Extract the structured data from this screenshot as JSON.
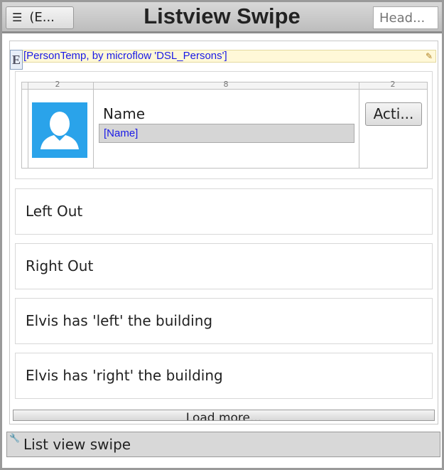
{
  "header": {
    "menu_label": "(E...",
    "title": "Listview Swipe",
    "search_placeholder": "Head..."
  },
  "datasource": {
    "label": "[PersonTemp, by microflow 'DSL_Persons']",
    "icon_letter": "E"
  },
  "layout_grid": {
    "columns": [
      "2",
      "8",
      "2"
    ]
  },
  "person": {
    "name_label": "Name",
    "name_value": "[Name]",
    "action_label": "Acti..."
  },
  "items": [
    {
      "label": "Left Out"
    },
    {
      "label": "Right Out"
    },
    {
      "label": "Elvis has 'left' the building"
    },
    {
      "label": "Elvis has 'right' the building"
    }
  ],
  "load_more": "Load more...",
  "footer": {
    "label": "List view swipe"
  },
  "colors": {
    "avatar_bg": "#2aa3ea",
    "link_text": "#1a1ae6"
  }
}
